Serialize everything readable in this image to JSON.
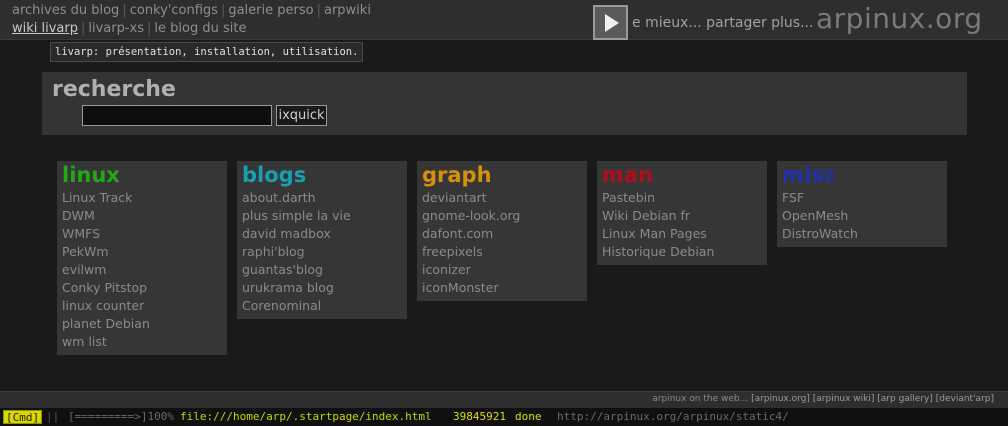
{
  "nav": {
    "row1": [
      "archives du blog",
      "conky'configs",
      "galerie perso",
      "arpwiki"
    ],
    "row2": [
      "wiki livarp",
      "livarp-xs",
      "le blog du site"
    ]
  },
  "motto": "e mieux... partager plus...",
  "site_title": "arpinux.org",
  "tooltip": "livarp: présentation, installation, utilisation.",
  "search": {
    "title": "recherche",
    "input_value": "",
    "button_label": "ixquick"
  },
  "sections": [
    {
      "title": "linux",
      "color": "#22a812",
      "items": [
        "Linux Track",
        "DWM",
        "WMFS",
        "PekWm",
        "evilwm",
        "Conky Pitstop",
        "linux counter",
        "planet Debian",
        "wm list"
      ]
    },
    {
      "title": "blogs",
      "color": "#18a0b0",
      "items": [
        "about.darth",
        "plus simple la vie",
        "david madbox",
        "raphi'blog",
        "guantas'blog",
        "urukrama blog",
        "Corenominal"
      ]
    },
    {
      "title": "graph",
      "color": "#d8900a",
      "items": [
        "deviantart",
        "gnome-look.org",
        "dafont.com",
        "freepixels",
        "iconizer",
        "iconMonster"
      ]
    },
    {
      "title": "man",
      "color": "#b00e1e",
      "items": [
        "Pastebin",
        "Wiki Debian fr",
        "Linux Man Pages",
        "Historique Debian"
      ]
    },
    {
      "title": "misc",
      "color": "#2030b0",
      "items": [
        "FSF",
        "OpenMesh",
        "DistroWatch"
      ]
    }
  ],
  "footer": {
    "prefix": "arpinux on the web...",
    "links": [
      "[arpinux.org]",
      "[arpinux wiki]",
      "[arp gallery]",
      "[deviant'arp]"
    ]
  },
  "statusbar": {
    "mode": "[Cmd]",
    "sep": "||",
    "progress": "[=========>]100%",
    "url": "file:///home/arp/.startpage/index.html",
    "number": "39845921",
    "state": "done",
    "hover_url": "http://arpinux.org/arpinux/static4/"
  }
}
